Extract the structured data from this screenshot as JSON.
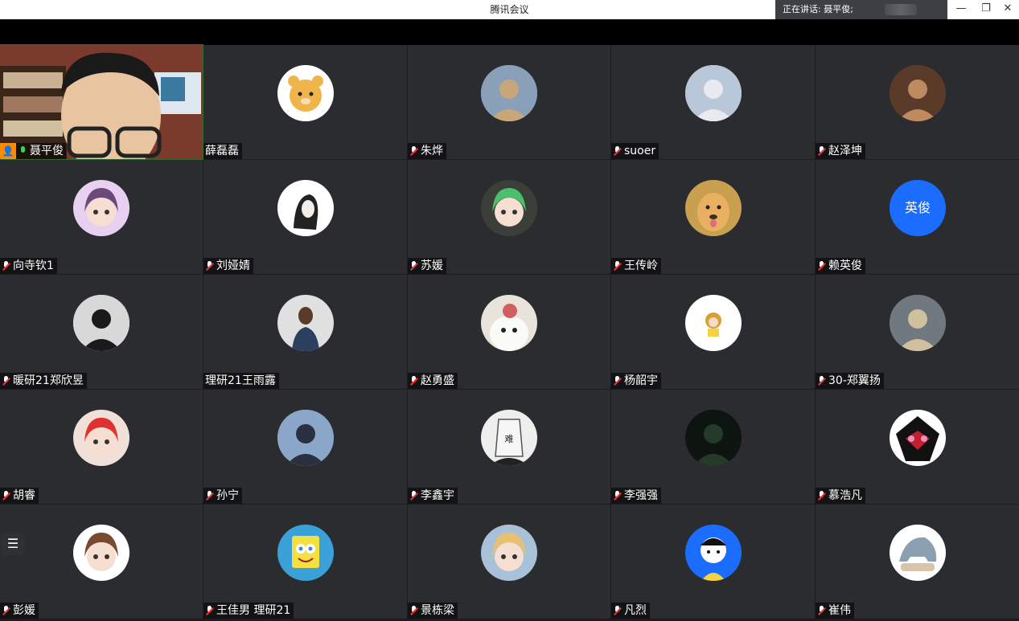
{
  "app": {
    "title": "腾讯会议",
    "speaking_label": "正在讲话: 聂平俊;"
  },
  "window_controls": {
    "minimize": "—",
    "restore": "❐",
    "close": "✕"
  },
  "participants": [
    {
      "name": "聂平俊",
      "mic": "on",
      "host": true,
      "type": "video"
    },
    {
      "name": "薛磊磊",
      "mic": "none",
      "avatar": "bear",
      "colors": [
        "#ffffff",
        "#f0b54a"
      ]
    },
    {
      "name": "朱烨",
      "mic": "muted",
      "avatar": "photo",
      "colors": [
        "#8aa0b8",
        "#c7a77a"
      ]
    },
    {
      "name": "suoer",
      "mic": "muted",
      "avatar": "photo",
      "colors": [
        "#b8c8d8",
        "#e9e9f0"
      ]
    },
    {
      "name": "赵泽坤",
      "mic": "muted",
      "avatar": "photo",
      "colors": [
        "#5a3a28",
        "#c08a60"
      ]
    },
    {
      "name": "向寺钦1",
      "mic": "muted",
      "avatar": "anime",
      "colors": [
        "#e8d0f0",
        "#6b4a7a"
      ]
    },
    {
      "name": "刘娅婧",
      "mic": "muted",
      "avatar": "ink",
      "colors": [
        "#ffffff",
        "#222222"
      ]
    },
    {
      "name": "苏媛",
      "mic": "muted",
      "avatar": "anime",
      "colors": [
        "#3a3f3a",
        "#4cbf6c"
      ]
    },
    {
      "name": "王传岭",
      "mic": "muted",
      "avatar": "dog",
      "colors": [
        "#c8a050",
        "#e8b060"
      ]
    },
    {
      "name": "赖英俊",
      "mic": "muted",
      "avatar": "text",
      "text": "英俊"
    },
    {
      "name": "暖研21郑欣昱",
      "mic": "muted",
      "avatar": "photo",
      "colors": [
        "#d8d8d8",
        "#1a1a1a"
      ]
    },
    {
      "name": "理研21王雨露",
      "mic": "none",
      "avatar": "girlback",
      "colors": [
        "#e0e0e0",
        "#2a4060"
      ]
    },
    {
      "name": "赵勇盛",
      "mic": "muted",
      "avatar": "seal",
      "colors": [
        "#e8e4dc",
        "#d06060"
      ]
    },
    {
      "name": "杨韶宇",
      "mic": "muted",
      "avatar": "cute",
      "colors": [
        "#ffffff",
        "#d8a030"
      ]
    },
    {
      "name": "30-郑翼扬",
      "mic": "muted",
      "avatar": "photo",
      "colors": [
        "#707880",
        "#d0c0a0"
      ]
    },
    {
      "name": "胡睿",
      "mic": "muted",
      "avatar": "anime",
      "colors": [
        "#f0e0d8",
        "#e03030"
      ]
    },
    {
      "name": "孙宁",
      "mic": "muted",
      "avatar": "photo",
      "colors": [
        "#8aa6c8",
        "#2a3040"
      ]
    },
    {
      "name": "李鑫宇",
      "mic": "muted",
      "avatar": "bag",
      "text": "难",
      "colors": [
        "#eeeeee",
        "#222222"
      ]
    },
    {
      "name": "李强强",
      "mic": "muted",
      "avatar": "photo",
      "colors": [
        "#0e1410",
        "#263a2a"
      ]
    },
    {
      "name": "慕浩凡",
      "mic": "muted",
      "avatar": "rider",
      "colors": [
        "#ffffff",
        "#c02030"
      ]
    },
    {
      "name": "彭媛",
      "mic": "muted",
      "avatar": "anime",
      "colors": [
        "#ffffff",
        "#7a4a30"
      ]
    },
    {
      "name": "王佳男 理研21",
      "mic": "muted",
      "avatar": "sponge",
      "colors": [
        "#3aa0d8",
        "#f4e040"
      ]
    },
    {
      "name": "景栋梁",
      "mic": "muted",
      "avatar": "anime",
      "colors": [
        "#a8c0d8",
        "#e8c070"
      ]
    },
    {
      "name": "凡烈",
      "mic": "muted",
      "avatar": "cartoon",
      "colors": [
        "#1a6dff",
        "#ffffff"
      ]
    },
    {
      "name": "崔伟",
      "mic": "muted",
      "avatar": "shark",
      "colors": [
        "#ffffff",
        "#8aa0b0"
      ]
    }
  ],
  "toolbar": {
    "list_icon": "☰"
  }
}
